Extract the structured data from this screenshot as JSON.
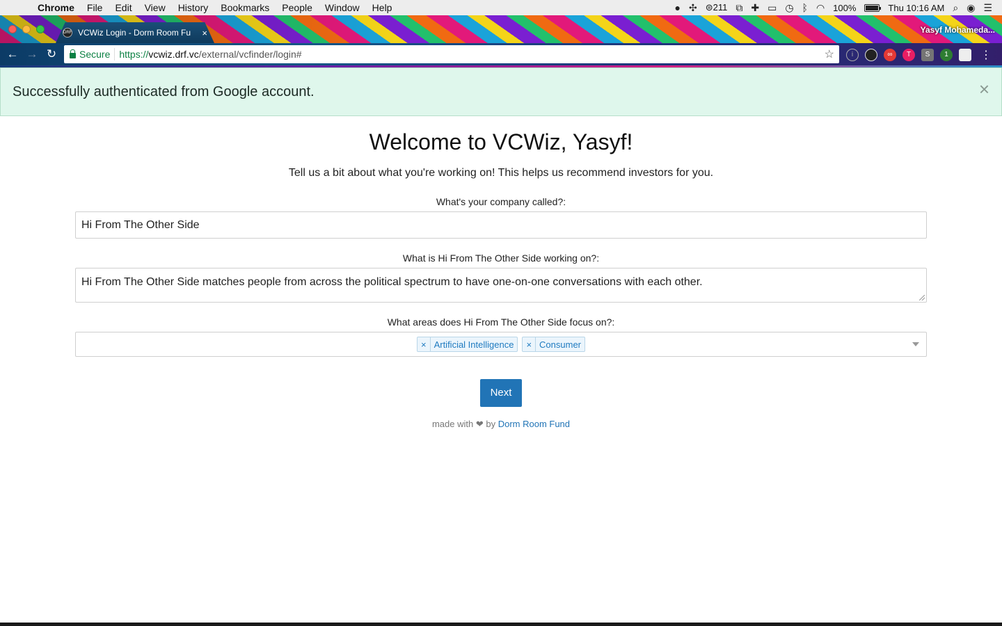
{
  "menubar": {
    "app": "Chrome",
    "items": [
      "File",
      "Edit",
      "View",
      "History",
      "Bookmarks",
      "People",
      "Window",
      "Help"
    ],
    "count": "211",
    "battery": "100%",
    "clock": "Thu 10:16 AM"
  },
  "tab": {
    "title": "VCWiz Login - Dorm Room Fu",
    "favicon": "DRF"
  },
  "profile": "Yasyf Mohameda...",
  "omnibox": {
    "secure_label": "Secure",
    "url_scheme": "https://",
    "url_host": "vcwiz.drf.vc",
    "url_path": "/external/vcfinder/login#"
  },
  "extensions": [
    {
      "icon": "ext-red-icon",
      "color": "#e53935"
    },
    {
      "icon": "ext-pink-icon",
      "color": "#e91e63"
    },
    {
      "icon": "ext-s-icon",
      "color": "#757575",
      "label": "S"
    },
    {
      "icon": "ext-green-icon",
      "color": "#2e7d32"
    },
    {
      "icon": "ext-white-icon",
      "color": "#eeeeee"
    }
  ],
  "alert": {
    "message": "Successfully authenticated from Google account.",
    "close": "×"
  },
  "page": {
    "heading": "Welcome to VCWiz, Yasyf!",
    "intro": "Tell us a bit about what you're working on! This helps us recommend investors for you.",
    "company_label": "What's your company called?:",
    "company_value": "Hi From The Other Side",
    "description_label": "What is Hi From The Other Side working on?:",
    "description_value": "Hi From The Other Side matches people from across the political spectrum to have one-on-one conversations with each other.",
    "areas_label": "What areas does Hi From The Other Side focus on?:",
    "areas": [
      "Artificial Intelligence",
      "Consumer"
    ],
    "chip_remove": "×",
    "next_label": "Next",
    "footer_prefix": "made with ❤ by",
    "footer_link": "Dorm Room Fund"
  },
  "colors": {
    "primary": "#2174b6",
    "alert_bg": "#dff7ec",
    "secure_green": "#0b8043"
  }
}
